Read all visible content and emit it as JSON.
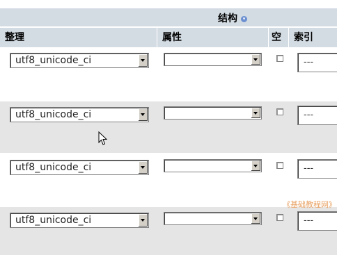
{
  "header": {
    "title": "结构",
    "title_icon": "circle-down-icon",
    "columns": [
      "整理",
      "属性",
      "空",
      "索引"
    ]
  },
  "rows": [
    {
      "collation": "utf8_unicode_ci",
      "attribute": "",
      "index": "---"
    },
    {
      "collation": "utf8_unicode_ci",
      "attribute": "",
      "index": "---"
    },
    {
      "collation": "utf8_unicode_ci",
      "attribute": "",
      "index": "---"
    },
    {
      "collation": "utf8_unicode_ci",
      "attribute": "",
      "index": "---"
    }
  ],
  "watermark": "《基础教程网》",
  "colors": {
    "header_bg": "#d3dce3",
    "row_alt_bg": "#e5e5e5"
  }
}
